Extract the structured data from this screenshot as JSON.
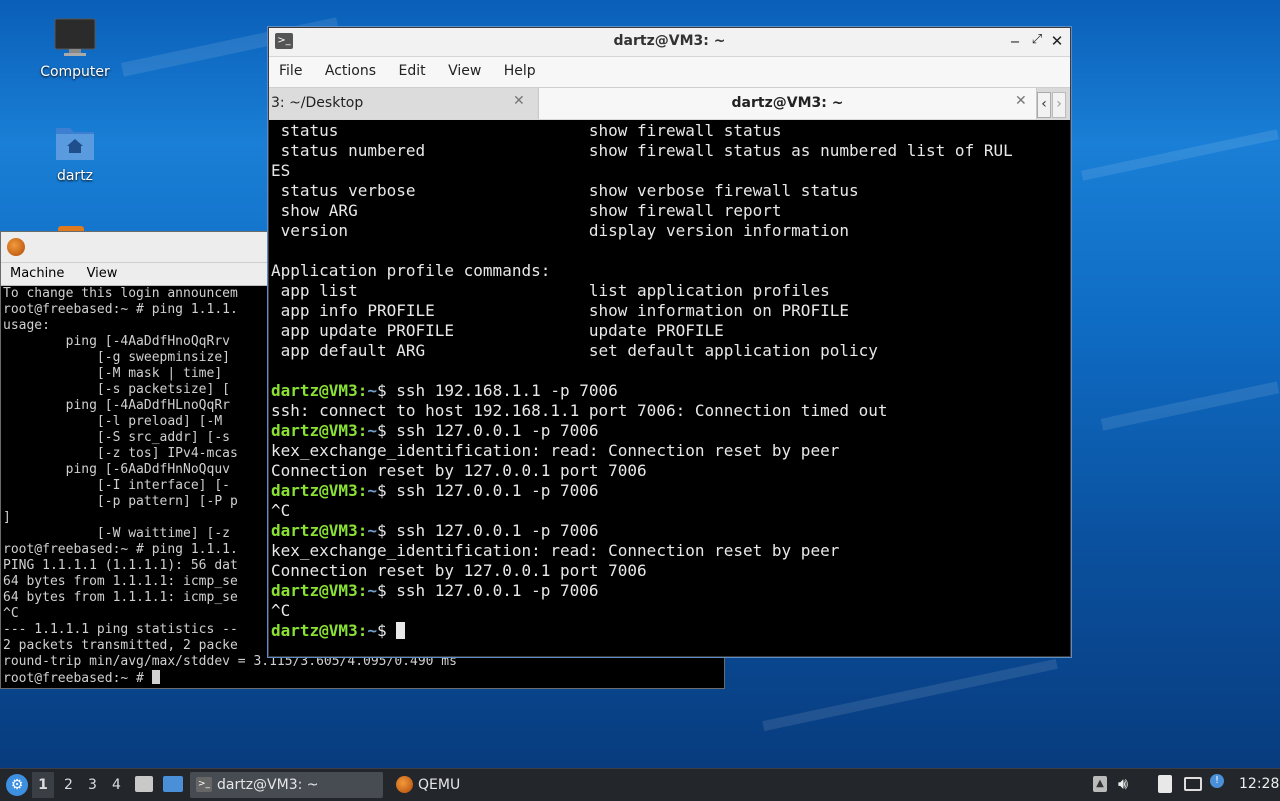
{
  "desktop": {
    "icons": [
      {
        "label": "Computer",
        "icon": "monitor-icon"
      },
      {
        "label": "dartz",
        "icon": "home-folder-icon"
      }
    ]
  },
  "qemu": {
    "menu": [
      "Machine",
      "View"
    ],
    "lines": [
      "To change this login announcem",
      "root@freebased:~ # ping 1.1.1.",
      "usage:",
      "        ping [-4AaDdfHnoQqRrv",
      "            [-g sweepminsize]",
      "            [-M mask | time] ",
      "            [-s packetsize] [",
      "        ping [-4AaDdfHLnoQqRr",
      "            [-l preload] [-M ",
      "            [-S src_addr] [-s",
      "            [-z tos] IPv4-mcas",
      "        ping [-6AaDdfHnNoQquv",
      "            [-I interface] [-",
      "            [-p pattern] [-P p",
      "]",
      "            [-W waittime] [-z",
      "root@freebased:~ # ping 1.1.1.",
      "PING 1.1.1.1 (1.1.1.1): 56 dat",
      "64 bytes from 1.1.1.1: icmp_se",
      "64 bytes from 1.1.1.1: icmp_se",
      "^C",
      "--- 1.1.1.1 ping statistics --",
      "2 packets transmitted, 2 packe",
      "round-trip min/avg/max/stddev = 3.115/3.605/4.095/0.490 ms",
      "root@freebased:~ # "
    ]
  },
  "terminal": {
    "title": "dartz@VM3: ~",
    "menu": [
      "File",
      "Actions",
      "Edit",
      "View",
      "Help"
    ],
    "tabs": [
      {
        "label": "3: ~/Desktop",
        "active": false
      },
      {
        "label": "dartz@VM3: ~",
        "active": true
      }
    ],
    "help_lines": [
      " status                          show firewall status",
      " status numbered                 show firewall status as numbered list of RUL",
      "ES",
      " status verbose                  show verbose firewall status",
      " show ARG                        show firewall report",
      " version                         display version information",
      "",
      "Application profile commands:",
      " app list                        list application profiles",
      " app info PROFILE                show information on PROFILE",
      " app update PROFILE              update PROFILE",
      " app default ARG                 set default application policy",
      ""
    ],
    "prompt_user": "dartz@VM3",
    "prompt_path": "~",
    "session": [
      {
        "type": "cmd",
        "text": "$ ssh 192.168.1.1 -p 7006"
      },
      {
        "type": "out",
        "text": "ssh: connect to host 192.168.1.1 port 7006: Connection timed out"
      },
      {
        "type": "cmd",
        "text": "$ ssh 127.0.0.1 -p 7006"
      },
      {
        "type": "out",
        "text": "kex_exchange_identification: read: Connection reset by peer"
      },
      {
        "type": "out",
        "text": "Connection reset by 127.0.0.1 port 7006"
      },
      {
        "type": "cmd",
        "text": "$ ssh 127.0.0.1 -p 7006"
      },
      {
        "type": "out",
        "text": "^C"
      },
      {
        "type": "cmd",
        "text": "$ ssh 127.0.0.1 -p 7006"
      },
      {
        "type": "out",
        "text": "kex_exchange_identification: read: Connection reset by peer"
      },
      {
        "type": "out",
        "text": "Connection reset by 127.0.0.1 port 7006"
      },
      {
        "type": "cmd",
        "text": "$ ssh 127.0.0.1 -p 7006"
      },
      {
        "type": "out",
        "text": "^C"
      },
      {
        "type": "cmd",
        "text": "$ "
      }
    ]
  },
  "taskbar": {
    "workspaces": [
      "1",
      "2",
      "3",
      "4"
    ],
    "active_workspace": "1",
    "tasks": [
      {
        "label": "dartz@VM3: ~",
        "icon": "terminal-icon",
        "active": true
      },
      {
        "label": "QEMU",
        "icon": "qemu-icon",
        "active": false
      }
    ],
    "clock": "12:28"
  }
}
